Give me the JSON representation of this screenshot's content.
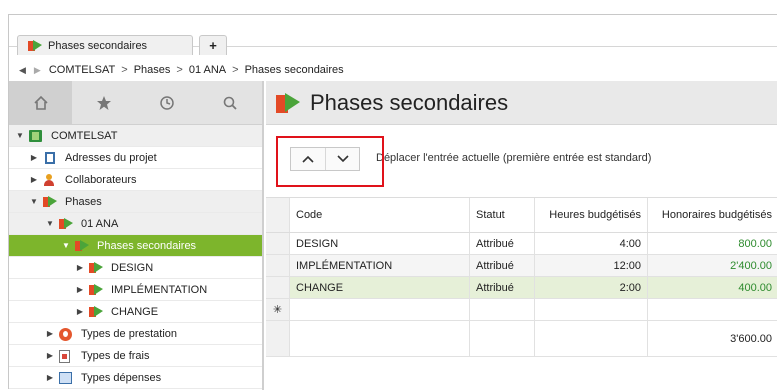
{
  "tabbar": {
    "active_tab": "Phases secondaires",
    "add_tab": "+"
  },
  "breadcrumb": {
    "items": [
      "COMTELSAT",
      "Phases",
      "01 ANA",
      "Phases secondaires"
    ],
    "separator": ">"
  },
  "sidebar": {
    "tools": [
      "home-icon",
      "star-icon",
      "clock-icon",
      "search-icon"
    ],
    "tree": [
      {
        "label": "COMTELSAT",
        "level": 0,
        "expanded": true,
        "icon": "project-icon"
      },
      {
        "label": "Adresses du projet",
        "level": 1,
        "expanded": false,
        "icon": "building-icon"
      },
      {
        "label": "Collaborateurs",
        "level": 1,
        "expanded": false,
        "icon": "user-icon"
      },
      {
        "label": "Phases",
        "level": 1,
        "expanded": true,
        "icon": "phase-icon"
      },
      {
        "label": "01 ANA",
        "level": 2,
        "expanded": true,
        "icon": "phase-icon"
      },
      {
        "label": "Phases secondaires",
        "level": 3,
        "expanded": true,
        "selected": true,
        "icon": "phase-icon"
      },
      {
        "label": "DESIGN",
        "level": 4,
        "expanded": false,
        "icon": "phase-icon"
      },
      {
        "label": "IMPLÉMENTATION",
        "level": 4,
        "expanded": false,
        "icon": "phase-icon"
      },
      {
        "label": "CHANGE",
        "level": 4,
        "expanded": false,
        "icon": "phase-icon"
      },
      {
        "label": "Types de prestation",
        "level": 2,
        "expanded": false,
        "icon": "prestation-icon"
      },
      {
        "label": "Types de frais",
        "level": 2,
        "expanded": false,
        "icon": "frais-icon"
      },
      {
        "label": "Types dépenses",
        "level": 2,
        "expanded": false,
        "icon": "depenses-icon"
      }
    ]
  },
  "main": {
    "title": "Phases secondaires",
    "toolbar": {
      "up": "∧",
      "down": "∨",
      "hint": "Déplacer l'entrée actuelle (première entrée est standard)"
    },
    "grid": {
      "headers": [
        "Code",
        "Statut",
        "Heures budgétisés",
        "Honoraires budgétisés"
      ],
      "rows": [
        {
          "code": "DESIGN",
          "statut": "Attribué",
          "heures": "4:00",
          "honoraires": "800.00"
        },
        {
          "code": "IMPLÉMENTATION",
          "statut": "Attribué",
          "heures": "12:00",
          "honoraires": "2'400.00"
        },
        {
          "code": "CHANGE",
          "statut": "Attribué",
          "heures": "2:00",
          "honoraires": "400.00"
        }
      ],
      "new_row_marker": "✳",
      "total_honoraires": "3'600.00"
    }
  },
  "colors": {
    "selected": "#7db52c",
    "highlight": "#e0121a",
    "amount": "#2e8b2e"
  }
}
